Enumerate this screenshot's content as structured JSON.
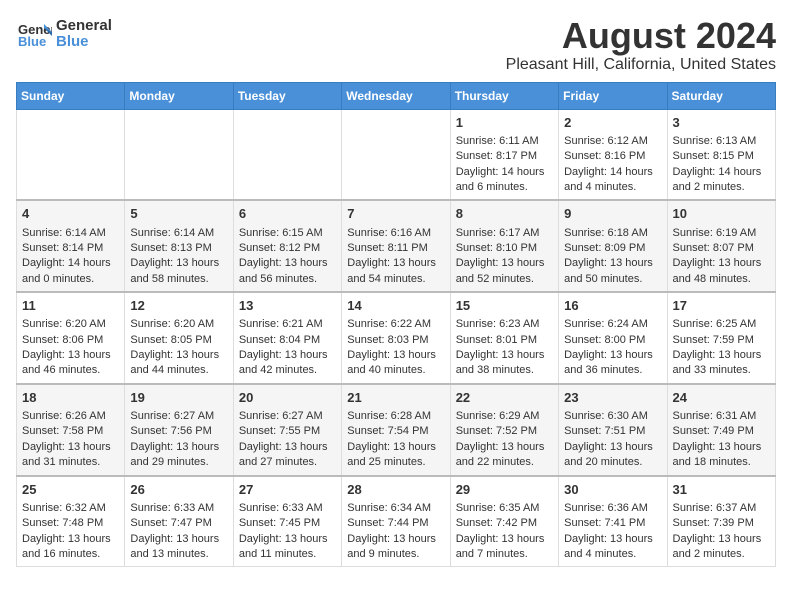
{
  "logo": {
    "line1": "General",
    "line2": "Blue"
  },
  "title": "August 2024",
  "subtitle": "Pleasant Hill, California, United States",
  "header_color": "#4a90d9",
  "days_of_week": [
    "Sunday",
    "Monday",
    "Tuesday",
    "Wednesday",
    "Thursday",
    "Friday",
    "Saturday"
  ],
  "weeks": [
    [
      {
        "day": "",
        "content": ""
      },
      {
        "day": "",
        "content": ""
      },
      {
        "day": "",
        "content": ""
      },
      {
        "day": "",
        "content": ""
      },
      {
        "day": "1",
        "content": "Sunrise: 6:11 AM\nSunset: 8:17 PM\nDaylight: 14 hours\nand 6 minutes."
      },
      {
        "day": "2",
        "content": "Sunrise: 6:12 AM\nSunset: 8:16 PM\nDaylight: 14 hours\nand 4 minutes."
      },
      {
        "day": "3",
        "content": "Sunrise: 6:13 AM\nSunset: 8:15 PM\nDaylight: 14 hours\nand 2 minutes."
      }
    ],
    [
      {
        "day": "4",
        "content": "Sunrise: 6:14 AM\nSunset: 8:14 PM\nDaylight: 14 hours\nand 0 minutes."
      },
      {
        "day": "5",
        "content": "Sunrise: 6:14 AM\nSunset: 8:13 PM\nDaylight: 13 hours\nand 58 minutes."
      },
      {
        "day": "6",
        "content": "Sunrise: 6:15 AM\nSunset: 8:12 PM\nDaylight: 13 hours\nand 56 minutes."
      },
      {
        "day": "7",
        "content": "Sunrise: 6:16 AM\nSunset: 8:11 PM\nDaylight: 13 hours\nand 54 minutes."
      },
      {
        "day": "8",
        "content": "Sunrise: 6:17 AM\nSunset: 8:10 PM\nDaylight: 13 hours\nand 52 minutes."
      },
      {
        "day": "9",
        "content": "Sunrise: 6:18 AM\nSunset: 8:09 PM\nDaylight: 13 hours\nand 50 minutes."
      },
      {
        "day": "10",
        "content": "Sunrise: 6:19 AM\nSunset: 8:07 PM\nDaylight: 13 hours\nand 48 minutes."
      }
    ],
    [
      {
        "day": "11",
        "content": "Sunrise: 6:20 AM\nSunset: 8:06 PM\nDaylight: 13 hours\nand 46 minutes."
      },
      {
        "day": "12",
        "content": "Sunrise: 6:20 AM\nSunset: 8:05 PM\nDaylight: 13 hours\nand 44 minutes."
      },
      {
        "day": "13",
        "content": "Sunrise: 6:21 AM\nSunset: 8:04 PM\nDaylight: 13 hours\nand 42 minutes."
      },
      {
        "day": "14",
        "content": "Sunrise: 6:22 AM\nSunset: 8:03 PM\nDaylight: 13 hours\nand 40 minutes."
      },
      {
        "day": "15",
        "content": "Sunrise: 6:23 AM\nSunset: 8:01 PM\nDaylight: 13 hours\nand 38 minutes."
      },
      {
        "day": "16",
        "content": "Sunrise: 6:24 AM\nSunset: 8:00 PM\nDaylight: 13 hours\nand 36 minutes."
      },
      {
        "day": "17",
        "content": "Sunrise: 6:25 AM\nSunset: 7:59 PM\nDaylight: 13 hours\nand 33 minutes."
      }
    ],
    [
      {
        "day": "18",
        "content": "Sunrise: 6:26 AM\nSunset: 7:58 PM\nDaylight: 13 hours\nand 31 minutes."
      },
      {
        "day": "19",
        "content": "Sunrise: 6:27 AM\nSunset: 7:56 PM\nDaylight: 13 hours\nand 29 minutes."
      },
      {
        "day": "20",
        "content": "Sunrise: 6:27 AM\nSunset: 7:55 PM\nDaylight: 13 hours\nand 27 minutes."
      },
      {
        "day": "21",
        "content": "Sunrise: 6:28 AM\nSunset: 7:54 PM\nDaylight: 13 hours\nand 25 minutes."
      },
      {
        "day": "22",
        "content": "Sunrise: 6:29 AM\nSunset: 7:52 PM\nDaylight: 13 hours\nand 22 minutes."
      },
      {
        "day": "23",
        "content": "Sunrise: 6:30 AM\nSunset: 7:51 PM\nDaylight: 13 hours\nand 20 minutes."
      },
      {
        "day": "24",
        "content": "Sunrise: 6:31 AM\nSunset: 7:49 PM\nDaylight: 13 hours\nand 18 minutes."
      }
    ],
    [
      {
        "day": "25",
        "content": "Sunrise: 6:32 AM\nSunset: 7:48 PM\nDaylight: 13 hours\nand 16 minutes."
      },
      {
        "day": "26",
        "content": "Sunrise: 6:33 AM\nSunset: 7:47 PM\nDaylight: 13 hours\nand 13 minutes."
      },
      {
        "day": "27",
        "content": "Sunrise: 6:33 AM\nSunset: 7:45 PM\nDaylight: 13 hours\nand 11 minutes."
      },
      {
        "day": "28",
        "content": "Sunrise: 6:34 AM\nSunset: 7:44 PM\nDaylight: 13 hours\nand 9 minutes."
      },
      {
        "day": "29",
        "content": "Sunrise: 6:35 AM\nSunset: 7:42 PM\nDaylight: 13 hours\nand 7 minutes."
      },
      {
        "day": "30",
        "content": "Sunrise: 6:36 AM\nSunset: 7:41 PM\nDaylight: 13 hours\nand 4 minutes."
      },
      {
        "day": "31",
        "content": "Sunrise: 6:37 AM\nSunset: 7:39 PM\nDaylight: 13 hours\nand 2 minutes."
      }
    ]
  ]
}
